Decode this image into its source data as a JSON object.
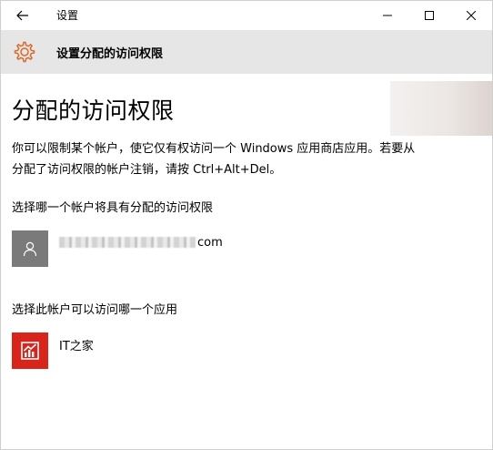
{
  "window": {
    "title": "设置",
    "icons": {
      "back": "back-arrow-icon",
      "minimize": "minimize-icon",
      "maximize": "maximize-icon",
      "close": "close-icon"
    }
  },
  "header": {
    "icon": "gear-icon",
    "title": "设置分配的访问权限"
  },
  "main": {
    "title": "分配的访问权限",
    "description": "你可以限制某个帐户，使它仅有权访问一个 Windows 应用商店应用。若要从分配了访问权限的帐户注销，请按 Ctrl+Alt+Del。",
    "account_section_label": "选择哪一个帐户将具有分配的访问权限",
    "account": {
      "name_suffix": "com",
      "avatar_icon": "user-avatar-icon"
    },
    "app_section_label": "选择此帐户可以访问哪一个应用",
    "app": {
      "name": "IT之家",
      "icon": "ithome-app-icon"
    }
  },
  "colors": {
    "header_band": "#e6e6e6",
    "gear_accent": "#d86a2c",
    "avatar_bg": "#7a7a7a",
    "app_icon_bg": "#d9241c"
  }
}
